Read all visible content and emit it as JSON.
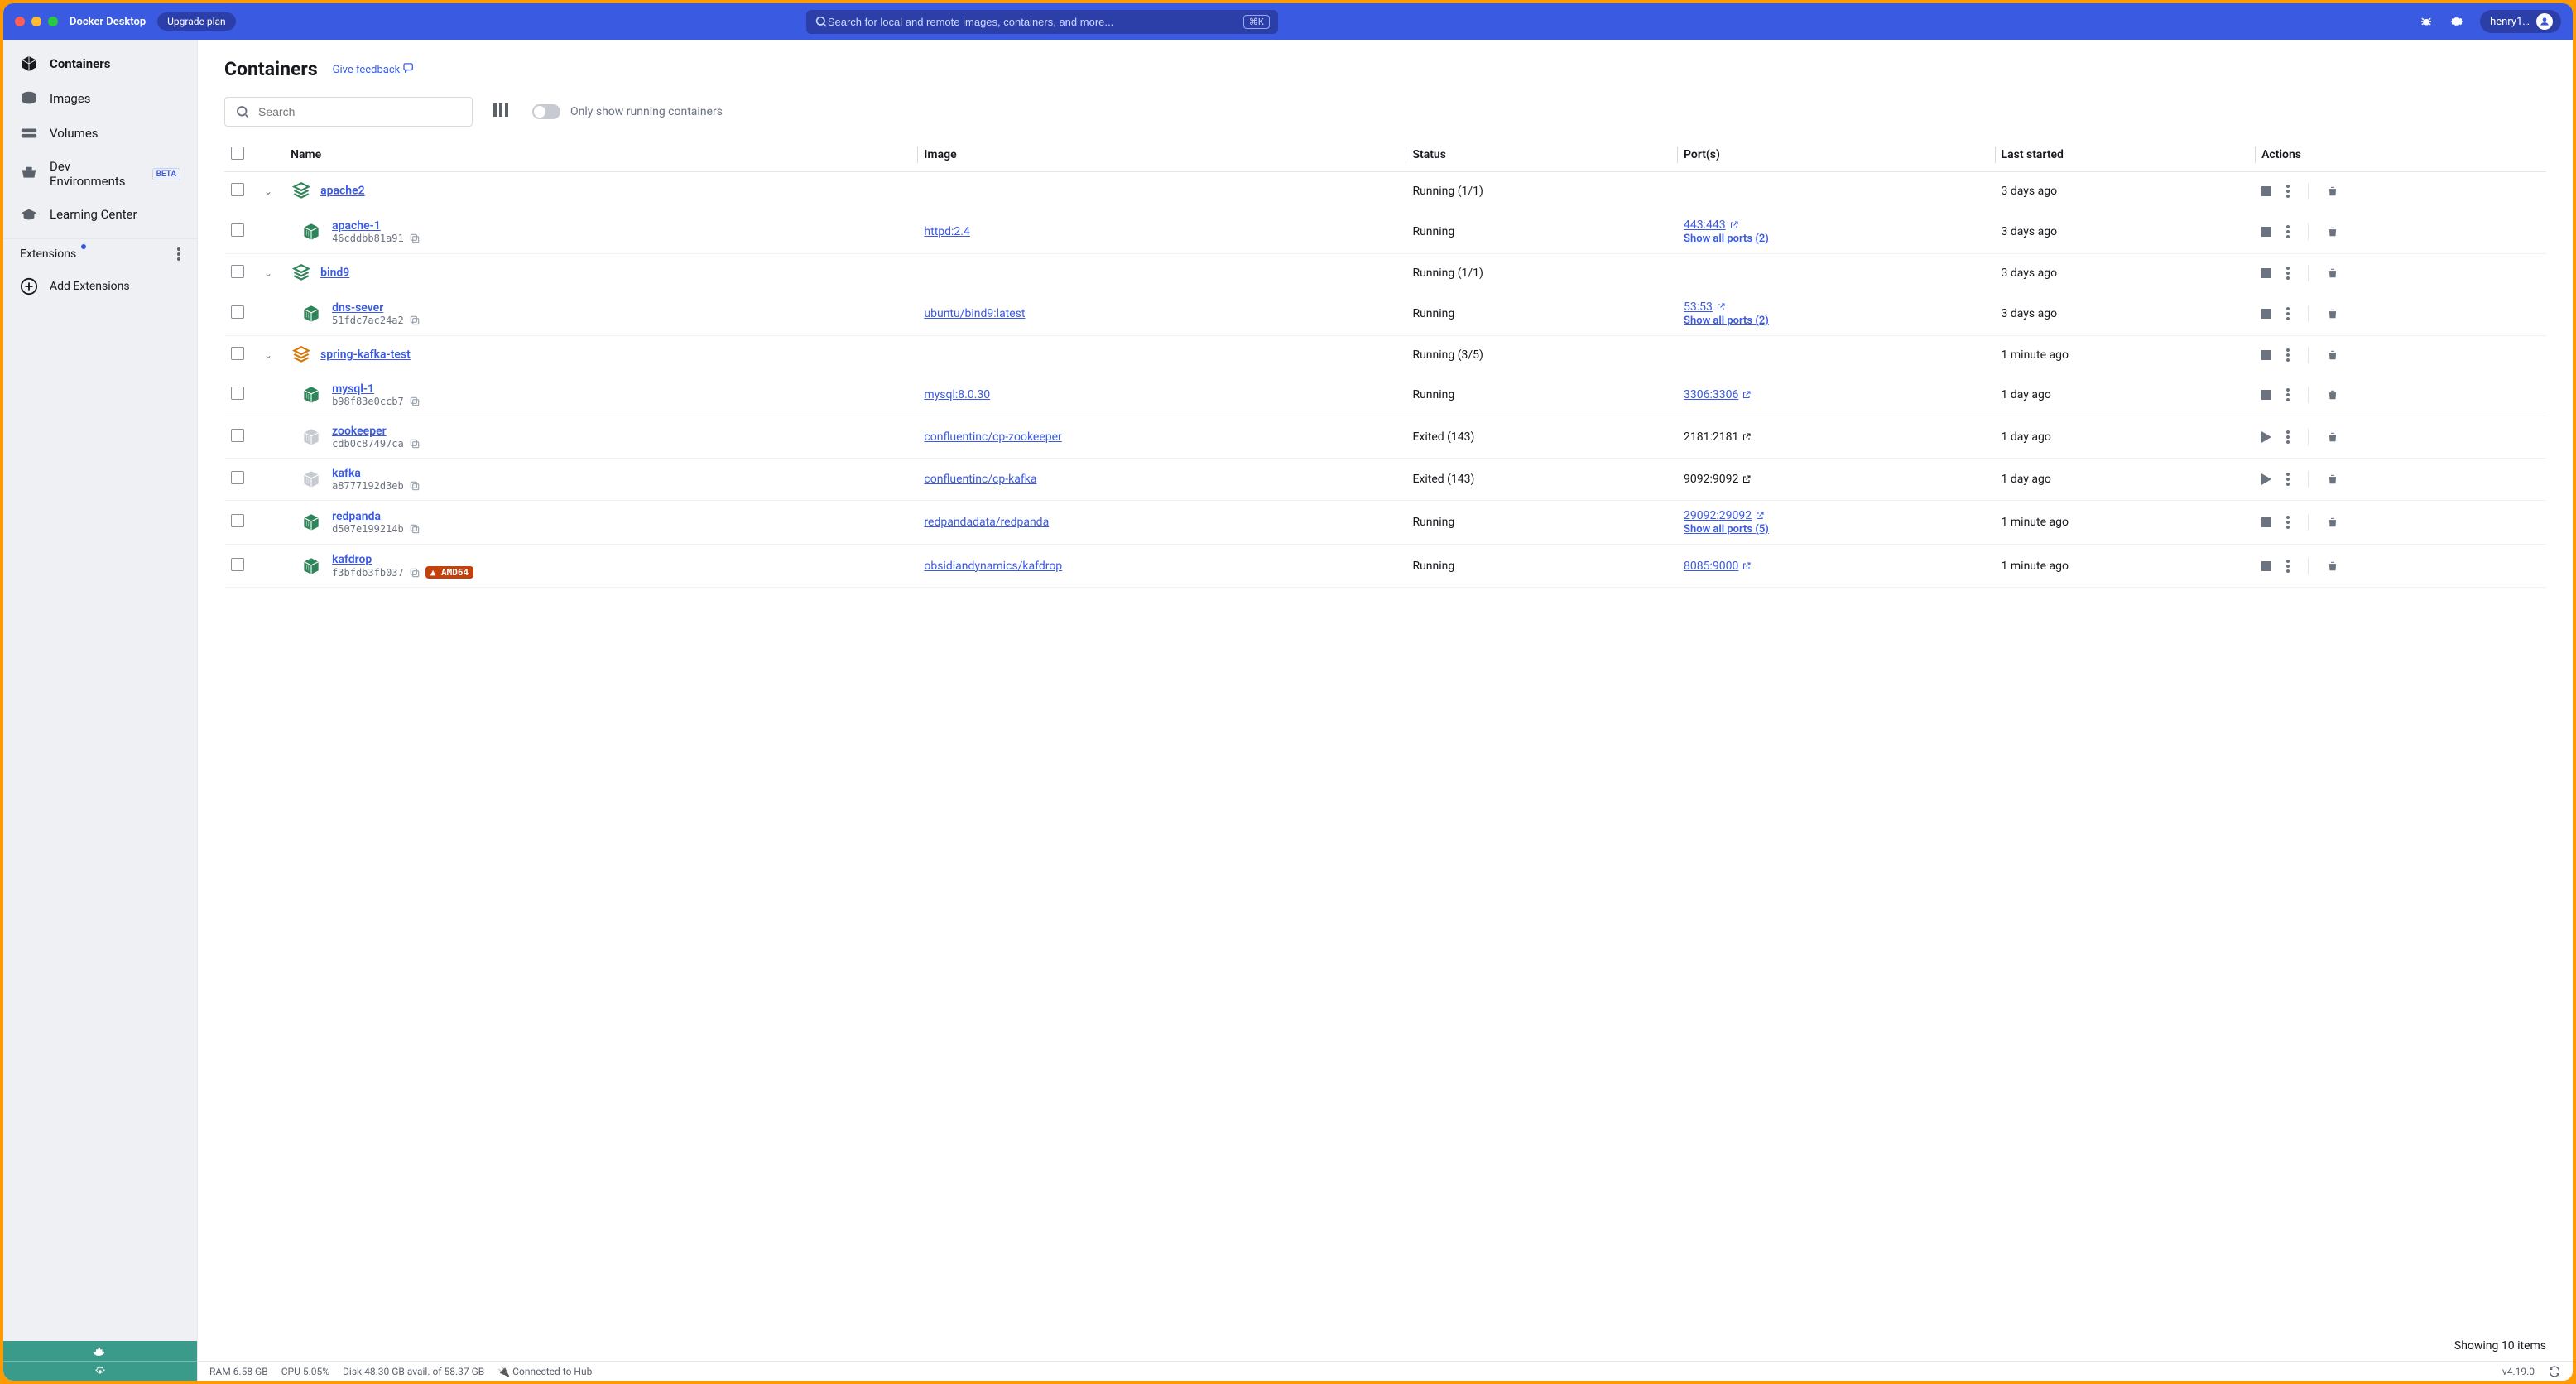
{
  "header": {
    "app_title": "Docker Desktop",
    "upgrade": "Upgrade plan",
    "search_placeholder": "Search for local and remote images, containers, and more...",
    "shortcut": "⌘K",
    "user": "henry1…"
  },
  "sidebar": {
    "items": [
      {
        "label": "Containers",
        "icon": "containers"
      },
      {
        "label": "Images",
        "icon": "images"
      },
      {
        "label": "Volumes",
        "icon": "volumes"
      },
      {
        "label": "Dev Environments",
        "icon": "dev",
        "beta": "BETA"
      },
      {
        "label": "Learning Center",
        "icon": "learn"
      }
    ],
    "extensions_header": "Extensions",
    "add_extensions": "Add Extensions"
  },
  "page": {
    "title": "Containers",
    "feedback": "Give feedback",
    "search_placeholder": "Search",
    "toggle_label": "Only show running containers",
    "columns": {
      "name": "Name",
      "image": "Image",
      "status": "Status",
      "ports": "Port(s)",
      "last_started": "Last started",
      "actions": "Actions"
    },
    "showing": "Showing 10 items"
  },
  "rows": [
    {
      "type": "group",
      "name": "apache2",
      "status": "Running (1/1)",
      "last": "3 days ago",
      "color": "green"
    },
    {
      "type": "sub",
      "name": "apache-1",
      "hash": "46cddbb81a91",
      "image": "httpd:2.4",
      "status": "Running",
      "port": "443:443",
      "showall": "Show all ports (2)",
      "last": "3 days ago",
      "color": "green",
      "shade": "on"
    },
    {
      "type": "group",
      "name": "bind9",
      "status": "Running (1/1)",
      "last": "3 days ago",
      "color": "green"
    },
    {
      "type": "sub",
      "name": "dns-sever",
      "hash": "51fdc7ac24a2",
      "image": "ubuntu/bind9:latest",
      "status": "Running",
      "port": "53:53",
      "showall": "Show all ports (2)",
      "last": "3 days ago",
      "color": "green",
      "shade": "on"
    },
    {
      "type": "group",
      "name": "spring-kafka-test",
      "status": "Running (3/5)",
      "last": "1 minute ago",
      "color": "orange"
    },
    {
      "type": "sub",
      "name": "mysql-1",
      "hash": "b98f83e0ccb7",
      "image": "mysql:8.0.30",
      "status": "Running",
      "port": "3306:3306",
      "last": "1 day ago",
      "color": "green",
      "shade": "on"
    },
    {
      "type": "sub",
      "name": "zookeeper",
      "hash": "cdb0c87497ca",
      "image": "confluentinc/cp-zookeeper",
      "status": "Exited (143)",
      "port": "2181:2181",
      "port_black": true,
      "last": "1 day ago",
      "color": "gray",
      "shade": "on",
      "play": true
    },
    {
      "type": "sub",
      "name": "kafka",
      "hash": "a8777192d3eb",
      "image": "confluentinc/cp-kafka",
      "status": "Exited (143)",
      "port": "9092:9092",
      "port_black": true,
      "last": "1 day ago",
      "color": "gray",
      "shade": "on",
      "play": true
    },
    {
      "type": "sub",
      "name": "redpanda",
      "hash": "d507e199214b",
      "image": "redpandadata/redpanda",
      "status": "Running",
      "port": "29092:29092",
      "showall": "Show all ports (5)",
      "last": "1 minute ago",
      "color": "green",
      "shade": "on"
    },
    {
      "type": "sub",
      "name": "kafdrop",
      "hash": "f3bfdb3fb037",
      "image": "obsidiandynamics/kafdrop",
      "status": "Running",
      "port": "8085:9000",
      "last": "1 minute ago",
      "color": "green",
      "shade": "on",
      "arch": "AMD64"
    }
  ],
  "status": {
    "ram": "RAM 6.58 GB",
    "cpu": "CPU 5.05%",
    "disk": "Disk 48.30 GB avail. of 58.37 GB",
    "conn": "Connected to Hub",
    "version": "v4.19.0"
  }
}
